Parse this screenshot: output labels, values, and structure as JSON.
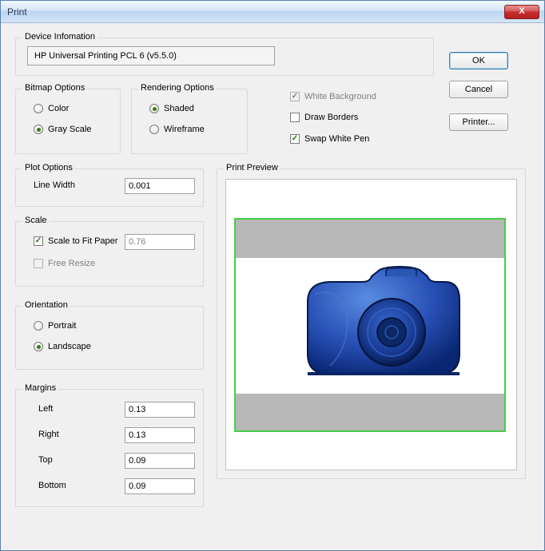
{
  "window": {
    "title": "Print"
  },
  "buttons": {
    "close_x": "X",
    "ok": "OK",
    "cancel": "Cancel",
    "printer": "Printer..."
  },
  "device_info": {
    "legend": "Device Infomation",
    "value": "HP Universal Printing PCL 6 (v5.5.0)"
  },
  "bitmap_options": {
    "legend": "Bitmap Options",
    "color": "Color",
    "gray_scale": "Gray Scale"
  },
  "rendering_options": {
    "legend": "Rendering Options",
    "shaded": "Shaded",
    "wireframe": "Wireframe"
  },
  "checks": {
    "white_bg": "White Background",
    "draw_borders": "Draw Borders",
    "swap_white_pen": "Swap White Pen"
  },
  "plot_options": {
    "legend": "Plot Options",
    "line_width_label": "Line Width",
    "line_width_value": "0.001"
  },
  "scale": {
    "legend": "Scale",
    "fit_paper": "Scale to Fit Paper",
    "fit_value": "0.76",
    "free_resize": "Free Resize"
  },
  "orientation": {
    "legend": "Orientation",
    "portrait": "Portrait",
    "landscape": "Landscape"
  },
  "margins": {
    "legend": "Margins",
    "left_label": "Left",
    "left_value": "0.13",
    "right_label": "Right",
    "right_value": "0.13",
    "top_label": "Top",
    "top_value": "0.09",
    "bottom_label": "Bottom",
    "bottom_value": "0.09"
  },
  "preview": {
    "legend": "Print Preview"
  }
}
